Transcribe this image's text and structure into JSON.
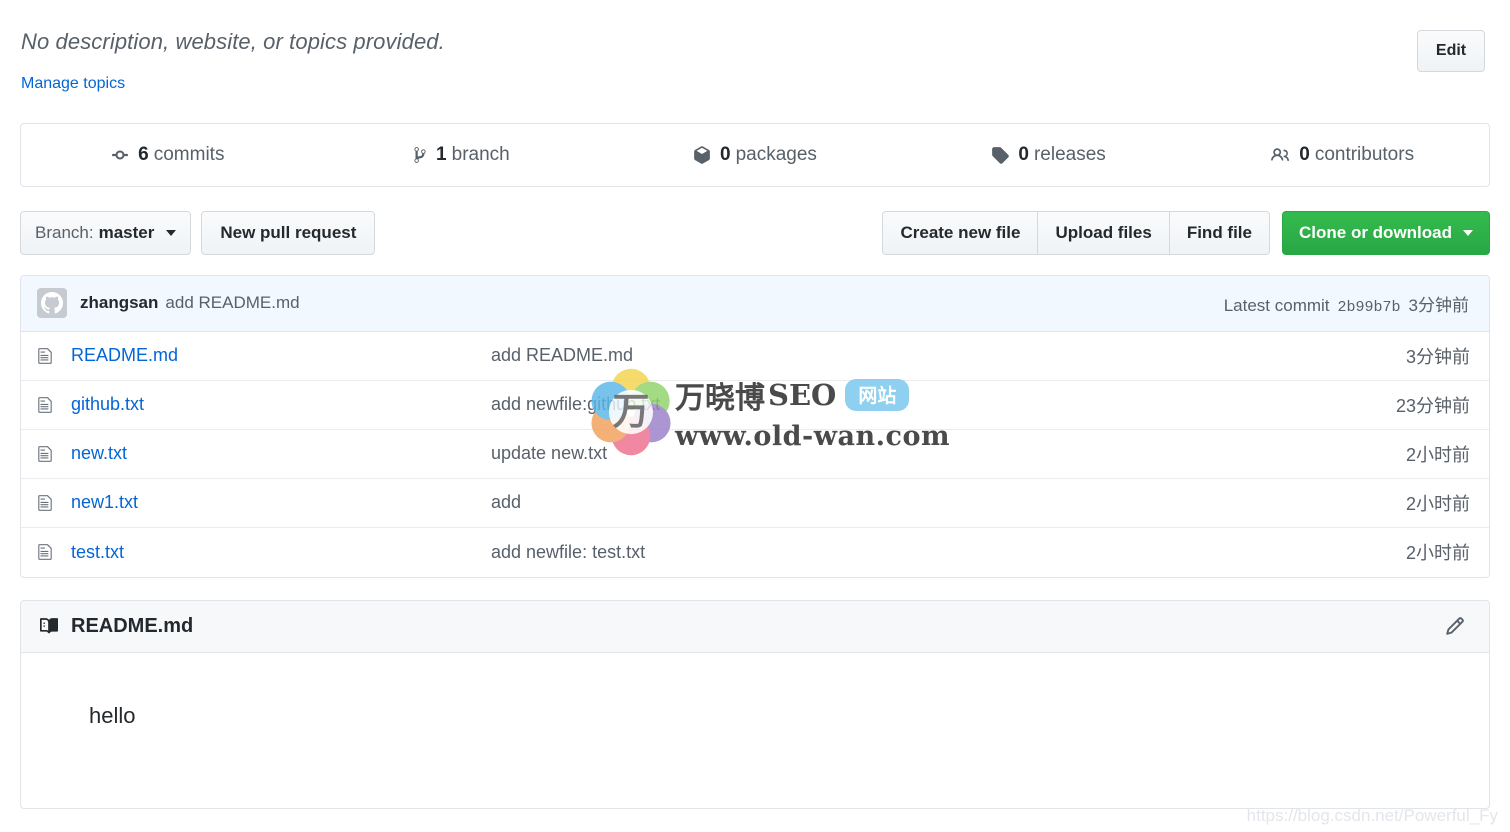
{
  "header": {
    "description": "No description, website, or topics provided.",
    "manage_topics_label": "Manage topics",
    "edit_button_label": "Edit"
  },
  "stats": [
    {
      "icon": "commit-icon",
      "count": "6",
      "label": "commits",
      "name": "stat-commits"
    },
    {
      "icon": "branch-icon",
      "count": "1",
      "label": "branch",
      "name": "stat-branches"
    },
    {
      "icon": "package-icon",
      "count": "0",
      "label": "packages",
      "name": "stat-packages"
    },
    {
      "icon": "tag-icon",
      "count": "0",
      "label": "releases",
      "name": "stat-releases"
    },
    {
      "icon": "people-icon",
      "count": "0",
      "label": "contributors",
      "name": "stat-contributors"
    }
  ],
  "toolbar": {
    "branch_prefix": "Branch:",
    "branch_name": "master",
    "new_pull_request_label": "New pull request",
    "create_new_file_label": "Create new file",
    "upload_files_label": "Upload files",
    "find_file_label": "Find file",
    "clone_or_download_label": "Clone or download"
  },
  "latest_commit": {
    "author": "zhangsan",
    "message": "add README.md",
    "prefix": "Latest commit",
    "hash": "2b99b7b",
    "time": "3分钟前"
  },
  "files": [
    {
      "name": "README.md",
      "commit": "add README.md",
      "time": "3分钟前"
    },
    {
      "name": "github.txt",
      "commit": "add newfile:github.txt",
      "time": "23分钟前"
    },
    {
      "name": "new.txt",
      "commit": "update new.txt",
      "time": "2小时前"
    },
    {
      "name": "new1.txt",
      "commit": "add",
      "time": "2小时前"
    },
    {
      "name": "test.txt",
      "commit": "add newfile: test.txt",
      "time": "2小时前"
    }
  ],
  "readme": {
    "title": "README.md",
    "body": "hello"
  },
  "watermark": {
    "brand_cn": "万晓博",
    "brand_en": "SEO",
    "badge": "网站",
    "url": "www.old-wan.com",
    "csdn": "https://blog.csdn.net/Powerful_Fy"
  },
  "colors": {
    "link": "#0366d6",
    "muted": "#586069",
    "clone_green": "#28a745",
    "commit_bar_bg": "#f1f8ff",
    "border": "#e1e4e8"
  }
}
